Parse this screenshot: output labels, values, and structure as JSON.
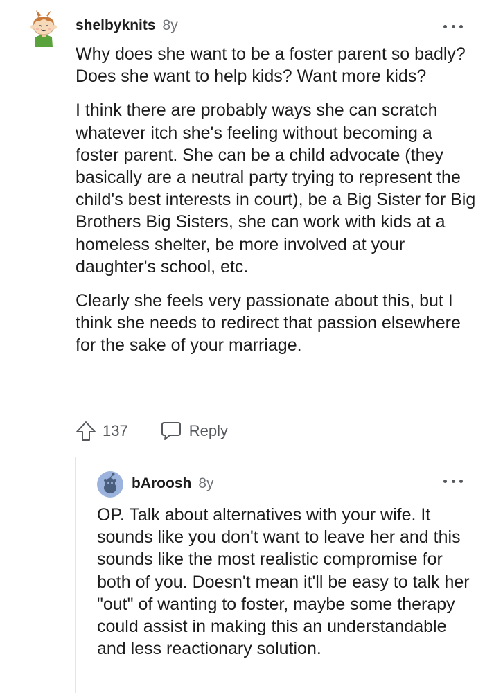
{
  "comment": {
    "username": "shelbyknits",
    "age": "8y",
    "paragraphs": [
      "Why does she want to be a foster parent so badly? Does she want to help kids? Want more kids?",
      "I think there are probably ways she can scratch whatever itch she's feeling without becoming a foster parent. She can be a child advocate (they basically are a neutral party trying to represent the child's best interests in court), be a Big Sister for Big Brothers Big Sisters, she can work with kids at a homeless shelter, be more involved at your daughter's school, etc.",
      "Clearly she feels very passionate about this, but I think she needs to redirect that passion elsewhere for the sake of your marriage."
    ],
    "votes": "137",
    "reply_label": "Reply",
    "avatar_icon": "snoo-avatar-icon",
    "upvote_icon": "upvote-arrow-icon",
    "reply_icon": "speech-bubble-icon",
    "more_icon": "more-options-icon"
  },
  "reply": {
    "username": "bAroosh",
    "age": "8y",
    "text": "OP. Talk about alternatives with your wife. It sounds like you don't want to leave her and this sounds like the most realistic compromise for both of you. Doesn't mean it'll be easy to talk her \"out\" of wanting to foster, maybe some therapy could assist in making this an understandable and less reactionary solution.",
    "avatar_icon": "default-snoo-avatar-icon",
    "more_icon": "more-options-icon"
  },
  "colors": {
    "text": "#1c1c1c",
    "muted": "#6f7378",
    "icon": "#55585c",
    "thread_line": "#e3e5e8",
    "avatar_blue": "#9cb4dd"
  }
}
